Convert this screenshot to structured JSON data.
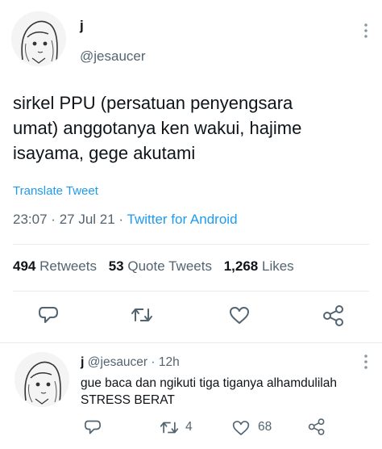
{
  "tweet": {
    "author_name": "j",
    "author_handle": "@jesaucer",
    "text_lines": [
      "sirkel PPU (persatuan penyengsara",
      "umat) anggotanya ken wakui, hajime",
      "isayama, gege akutami"
    ],
    "translate_label": "Translate Tweet",
    "time": "23:07",
    "date": "27 Jul 21",
    "separator": "·",
    "source": "Twitter for Android",
    "retweets_count": "494",
    "retweets_label": "Retweets",
    "quote_count": "53",
    "quote_label": "Quote Tweets",
    "likes_count": "1,268",
    "likes_label": "Likes"
  },
  "reply": {
    "author_name": "j",
    "author_handle": "@jesaucer",
    "separator": "·",
    "age": "12h",
    "text_lines": [
      "gue baca dan ngikuti tiga tiganya alhamdulilah",
      "STRESS BERAT"
    ],
    "retweet_count": "4",
    "like_count": "68"
  },
  "colors": {
    "link": "#1d9bf0",
    "secondary": "#536471",
    "divider": "#e6ecf0"
  },
  "icons": [
    "more-icon",
    "reply-icon",
    "retweet-icon",
    "like-icon",
    "share-icon"
  ]
}
